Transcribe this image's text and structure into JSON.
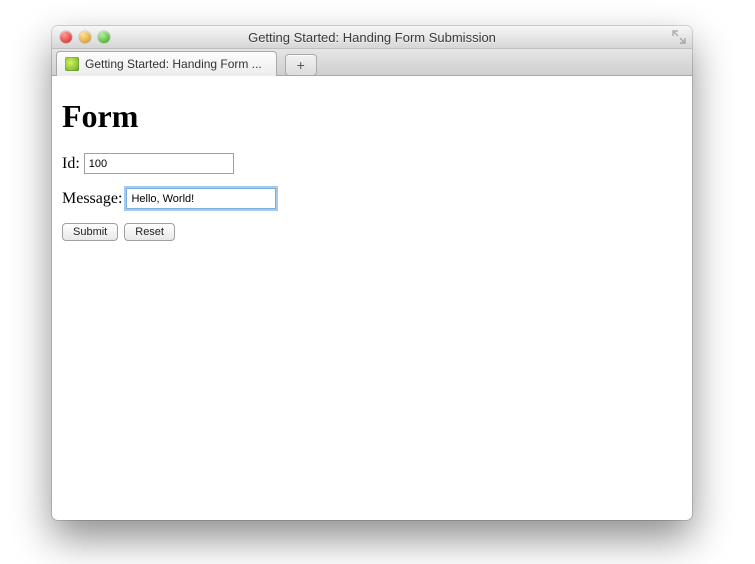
{
  "window": {
    "title": "Getting Started: Handing Form Submission"
  },
  "tab": {
    "label": "Getting Started: Handing Form ..."
  },
  "page": {
    "heading": "Form"
  },
  "form": {
    "id_label": "Id:",
    "id_value": "100",
    "message_label": "Message:",
    "message_value": "Hello, World!",
    "submit_label": "Submit",
    "reset_label": "Reset"
  }
}
